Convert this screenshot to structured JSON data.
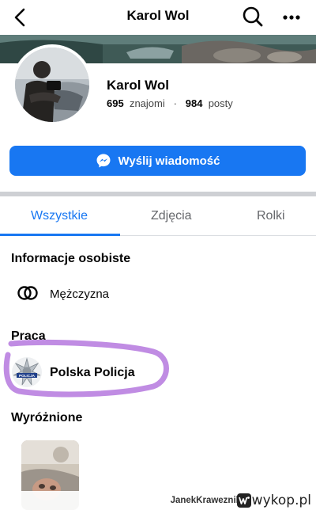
{
  "header": {
    "title": "Karol Wol",
    "back_icon": "chevron-left-icon",
    "search_icon": "search-icon",
    "more_icon": "more-dots-icon"
  },
  "profile": {
    "name": "Karol Wol",
    "friends_count": "695",
    "friends_label": "znajomi",
    "separator": "·",
    "posts_count": "984",
    "posts_label": "posty"
  },
  "message_button": {
    "label": "Wyślij wiadomość",
    "icon": "messenger-icon"
  },
  "tabs": [
    {
      "label": "Wszystkie",
      "active": true
    },
    {
      "label": "Zdjęcia",
      "active": false
    },
    {
      "label": "Rolki",
      "active": false
    }
  ],
  "sections": {
    "personal": {
      "title": "Informacje osobiste",
      "gender": "Mężczyzna",
      "icon": "gender-rings-icon"
    },
    "work": {
      "title": "Praca",
      "employer": "Polska Policja",
      "icon": "police-badge-icon",
      "badge_text": "POLICJA"
    },
    "featured": {
      "title": "Wyróżnione"
    }
  },
  "footer": {
    "text": "JanekKraweznik z",
    "brand": "wykop.pl"
  },
  "colors": {
    "accent": "#1877f2",
    "highlight_marker": "#b97fe0",
    "divider": "#ced0d4"
  }
}
